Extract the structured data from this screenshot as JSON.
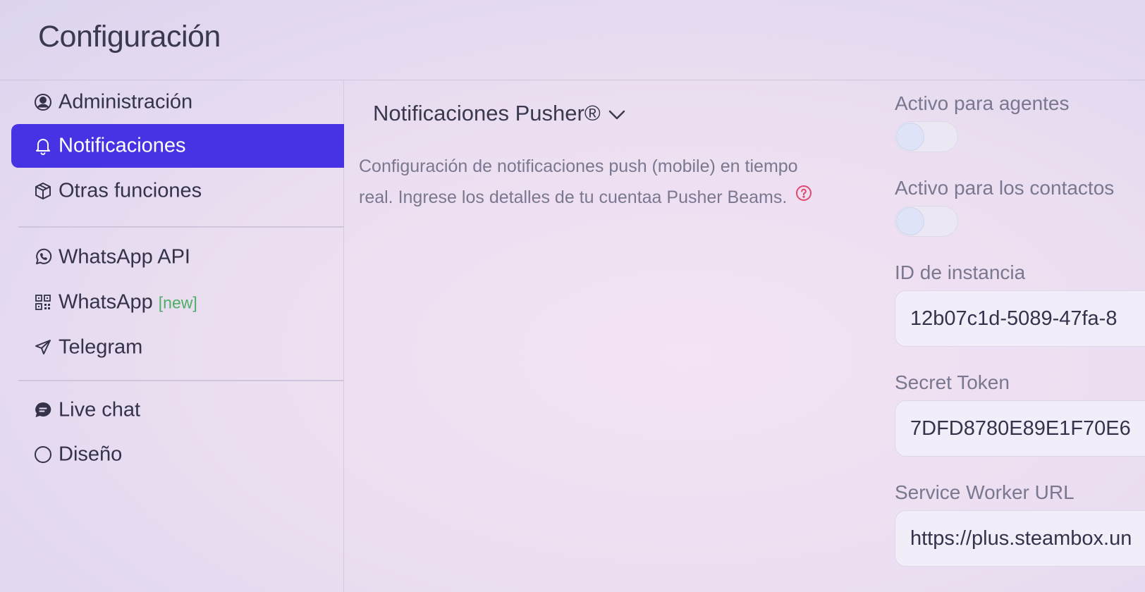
{
  "header": {
    "title": "Configuración"
  },
  "sidebar": {
    "items": [
      {
        "label": "Administración",
        "icon": "user-circle-icon"
      },
      {
        "label": "Notificaciones",
        "icon": "bell-icon",
        "active": true
      },
      {
        "label": "Otras funciones",
        "icon": "cube-icon"
      },
      {
        "label": "WhatsApp API",
        "icon": "whatsapp-icon"
      },
      {
        "label": "WhatsApp",
        "badge": "[new]",
        "icon": "qr-code-icon"
      },
      {
        "label": "Telegram",
        "icon": "send-icon"
      },
      {
        "label": "Live chat",
        "icon": "chat-bubble-icon"
      },
      {
        "label": "Diseño",
        "icon": "circle-icon"
      }
    ]
  },
  "main": {
    "section_title": "Notificaciones Pusher®",
    "description": "Configuración de notificaciones push (mobile) en tiempo real. Ingrese los detalles de tu cuentaa Pusher Beams.",
    "fields": {
      "agents_toggle": {
        "label": "Activo para agentes",
        "checked": false
      },
      "contacts_toggle": {
        "label": "Activo para los contactos",
        "checked": false
      },
      "instance_id": {
        "label": "ID de instancia",
        "value": "12b07c1d-5089-47fa-8"
      },
      "secret_token": {
        "label": "Secret Token",
        "value": "7DFD8780E89E1F70E6"
      },
      "service_worker_url": {
        "label": "Service Worker URL",
        "value": "https://plus.steambox.un"
      }
    }
  },
  "colors": {
    "accent": "#4733e3",
    "new_badge": "#4caf63",
    "help_icon": "#e2476f"
  }
}
